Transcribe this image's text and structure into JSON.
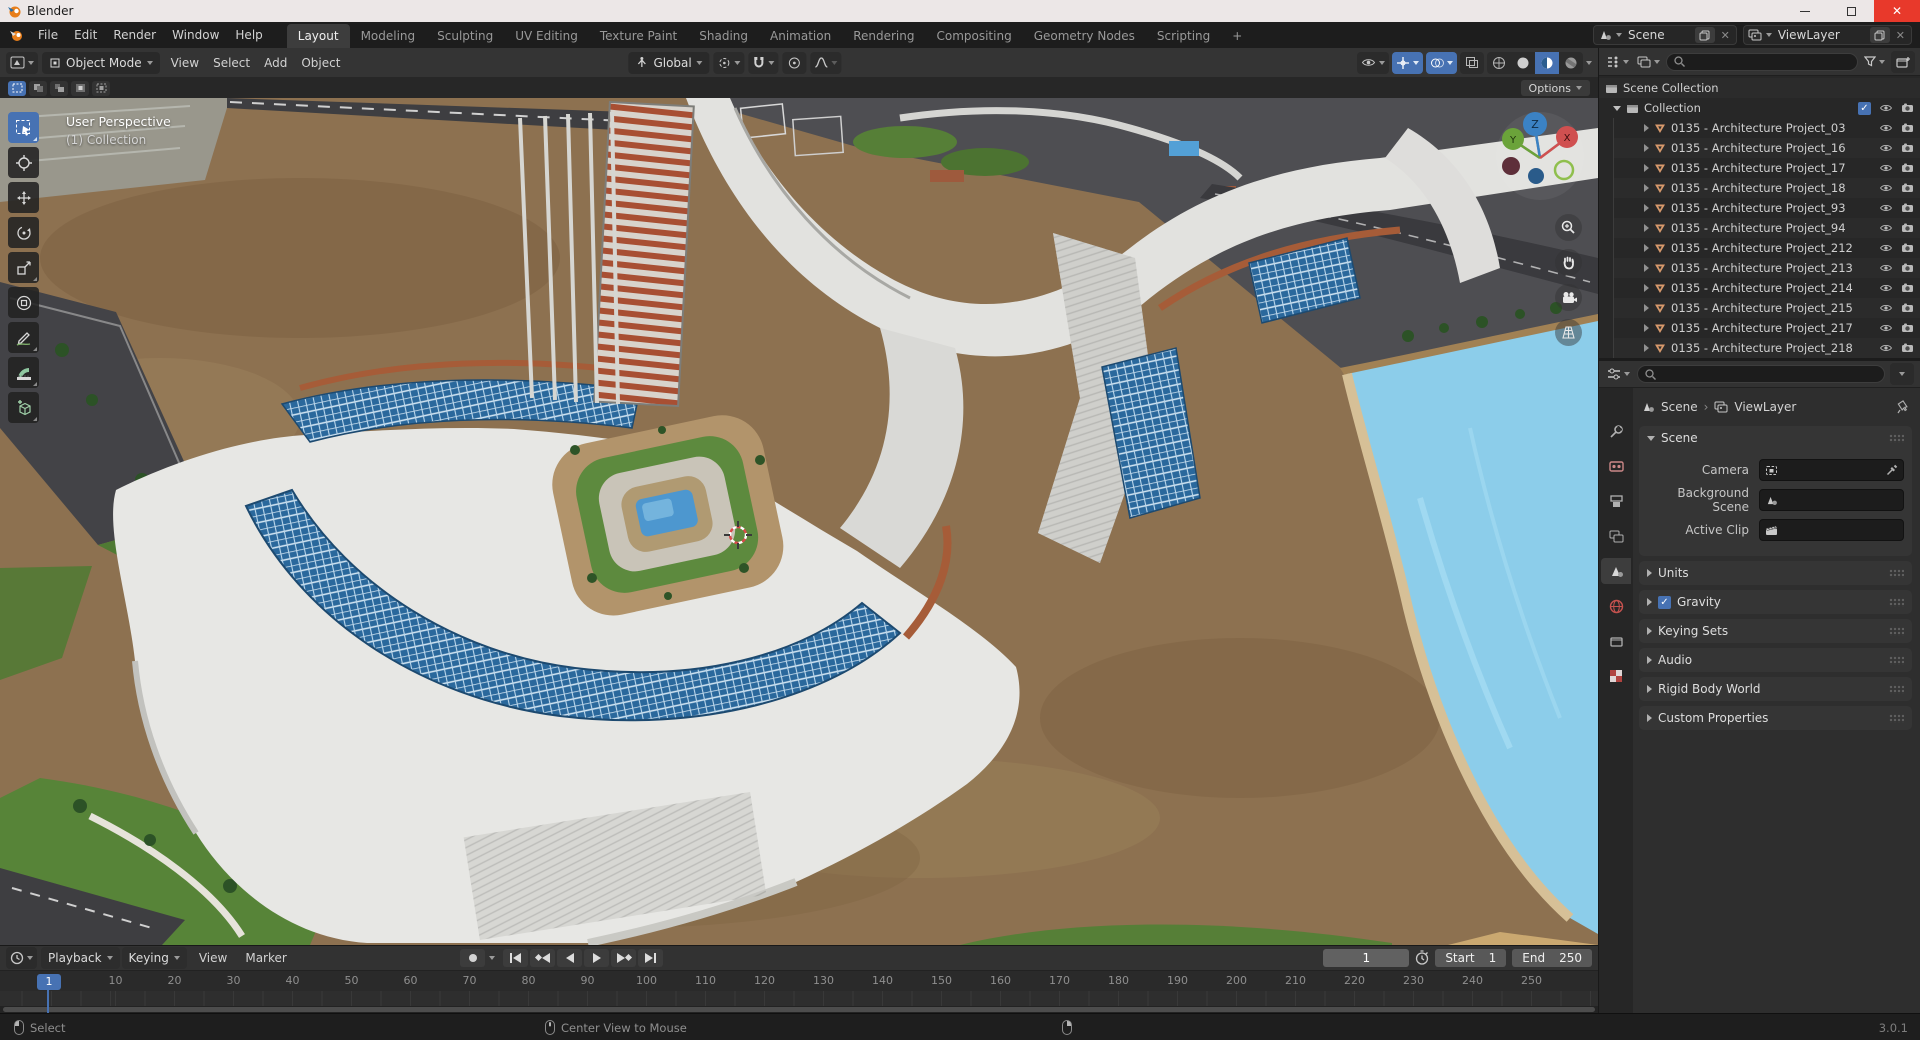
{
  "window": {
    "title": "Blender"
  },
  "topbar": {
    "menus": [
      "File",
      "Edit",
      "Render",
      "Window",
      "Help"
    ],
    "tabs": [
      {
        "label": "Layout",
        "active": true
      },
      {
        "label": "Modeling"
      },
      {
        "label": "Sculpting"
      },
      {
        "label": "UV Editing"
      },
      {
        "label": "Texture Paint"
      },
      {
        "label": "Shading"
      },
      {
        "label": "Animation"
      },
      {
        "label": "Rendering"
      },
      {
        "label": "Compositing"
      },
      {
        "label": "Geometry Nodes"
      },
      {
        "label": "Scripting"
      },
      {
        "label": "+"
      }
    ],
    "scene": "Scene",
    "viewlayer": "ViewLayer"
  },
  "viewport": {
    "mode": "Object Mode",
    "menus": [
      "View",
      "Select",
      "Add",
      "Object"
    ],
    "orientation": "Global",
    "options": "Options",
    "overlay": {
      "line1": "User Perspective",
      "line2": "(1) Collection"
    },
    "axis": {
      "x": "X",
      "y": "Y",
      "z": "Z"
    }
  },
  "outliner": {
    "root": "Scene Collection",
    "collection": "Collection",
    "collection_check": "✓",
    "items": [
      "0135 - Architecture Project_03",
      "0135 - Architecture Project_16",
      "0135 - Architecture Project_17",
      "0135 - Architecture Project_18",
      "0135 - Architecture Project_93",
      "0135 - Architecture Project_94",
      "0135 - Architecture Project_212",
      "0135 - Architecture Project_213",
      "0135 - Architecture Project_214",
      "0135 - Architecture Project_215",
      "0135 - Architecture Project_217",
      "0135 - Architecture Project_218"
    ]
  },
  "properties": {
    "path": {
      "scene": "Scene",
      "sep": "›",
      "viewlayer": "ViewLayer"
    },
    "scene_panel": {
      "title": "Scene",
      "camera": "Camera",
      "background": "Background Scene",
      "clip": "Active Clip"
    },
    "panels": [
      {
        "label": "Units"
      },
      {
        "label": "Gravity",
        "check": "✓"
      },
      {
        "label": "Keying Sets"
      },
      {
        "label": "Audio"
      },
      {
        "label": "Rigid Body World"
      },
      {
        "label": "Custom Properties"
      }
    ]
  },
  "timeline": {
    "dd_menus": [
      "Playback",
      "Keying"
    ],
    "menus": [
      "View",
      "Marker"
    ],
    "frame": "1",
    "start_label": "Start",
    "start_value": "1",
    "end_label": "End",
    "end_value": "250",
    "playhead": "1",
    "ruler": [
      "10",
      "20",
      "30",
      "40",
      "50",
      "60",
      "70",
      "80",
      "90",
      "100",
      "110",
      "120",
      "130",
      "140",
      "150",
      "160",
      "170",
      "180",
      "190",
      "200",
      "210",
      "220",
      "230",
      "240",
      "250"
    ]
  },
  "status": {
    "select": "Select",
    "center": "Center View to Mouse",
    "version": "3.0.1"
  },
  "colors": {
    "accent": "#4772b3",
    "mesh_icon": "#d99a6c",
    "water": "#8ccdea",
    "close_button": "#e8392b"
  }
}
